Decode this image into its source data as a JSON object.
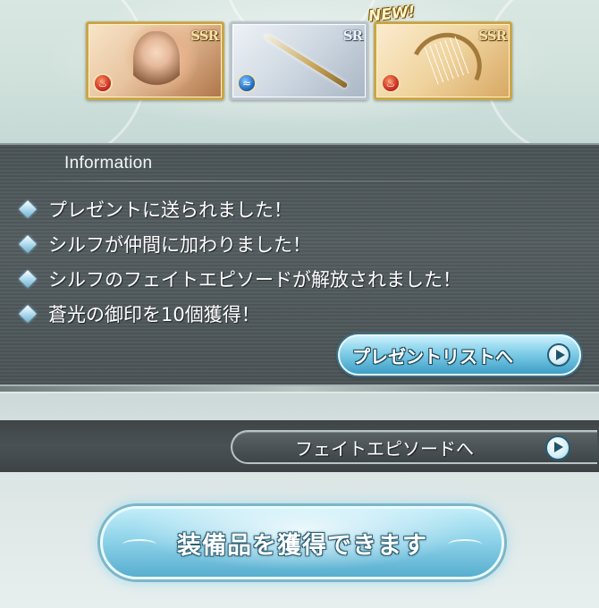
{
  "banner": {
    "new_badge": "NEW!",
    "cards": [
      {
        "rarity": "SSR",
        "element": "fire",
        "element_icon": "fire-element-icon",
        "kind": "character"
      },
      {
        "rarity": "SR",
        "element": "water",
        "element_icon": "water-element-icon",
        "kind": "sword"
      },
      {
        "rarity": "SSR",
        "element": "fire",
        "element_icon": "fire-element-icon",
        "kind": "harp"
      }
    ]
  },
  "info": {
    "title": "Information",
    "messages": [
      "プレゼントに送られました！",
      "シルフが仲間に加わりました！",
      "シルフのフェイトエピソードが解放されました！",
      "蒼光の御印を10個獲得！"
    ],
    "present_button": "プレゼントリストへ"
  },
  "fate_button": "フェイトエピソードへ",
  "acquire_button": "装備品を獲得できます",
  "colors": {
    "panel": "#4f585b",
    "button_blue": "#7fcde8",
    "gold_frame": "#c9a64a"
  }
}
